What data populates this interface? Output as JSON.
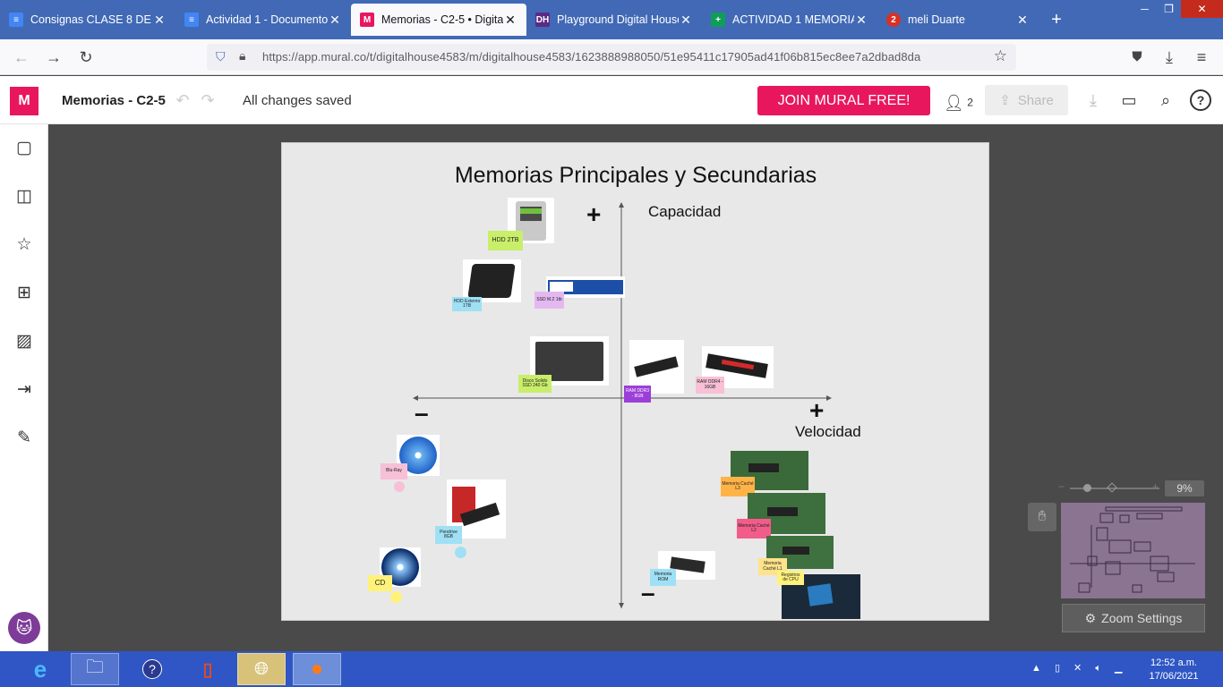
{
  "browser": {
    "tabs": [
      {
        "label": "Consignas CLASE 8 DE INT",
        "icon": "docs-icon",
        "color": "#4285f4"
      },
      {
        "label": "Actividad 1 - Documentos",
        "icon": "docs-icon",
        "color": "#4285f4"
      },
      {
        "label": "Memorias - C2-5 • Digital H",
        "icon": "mural-icon",
        "color": "#e8175d",
        "active": true
      },
      {
        "label": "Playground Digital House",
        "icon": "dh-icon",
        "color": "#5b2a86"
      },
      {
        "label": "ACTIVIDAD 1 MEMORIA G",
        "icon": "sheets-icon",
        "color": "#0f9d58"
      },
      {
        "label": "meli Duarte",
        "icon": "meet-icon",
        "color": "#d93025"
      }
    ],
    "url": "https://app.mural.co/t/digitalhouse4583/m/digitalhouse4583/1623888988050/51e95411c17905ad41f06b815ec8ee7a2dbad8da"
  },
  "mural": {
    "title": "Memorias - C2-5",
    "status": "All changes saved",
    "join_label": "JOIN MURAL FREE!",
    "user_count": "2",
    "share_label": "Share"
  },
  "board": {
    "title": "Memorias Principales y Secundarias",
    "y_axis_label": "Capacidad",
    "x_axis_label": "Velocidad",
    "plus": "+",
    "minus": "–",
    "stickies": {
      "hdd2tb": "HDD 2TB",
      "hddext": "HDD Externo 1TB",
      "ssdm2": "SSD M.2 1tb",
      "ssd": "Disco Solido SSD 240 Gb",
      "ram3": "RAM DDR3 - 8GB",
      "ram4": "RAM DDR4 - 16GB",
      "bluray": "Blu-Ray",
      "pendrive": "Pendrive 8GB",
      "cd": "CD",
      "rom": "Memoria ROM",
      "l3": "Memoria Caché L3",
      "l2": "Memoria Caché L2",
      "l1": "Memoria Caché L1",
      "reg": "Registros de CPU"
    }
  },
  "zoom": {
    "percent": "9%",
    "settings_label": "Zoom Settings"
  },
  "taskbar": {
    "time": "12:52 a.m.",
    "date": "17/06/2021"
  }
}
